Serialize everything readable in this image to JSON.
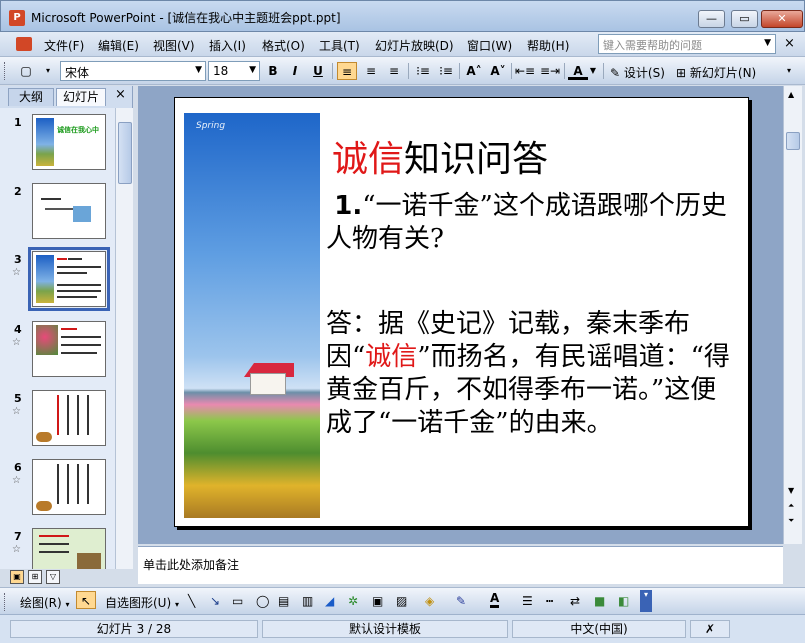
{
  "window": {
    "title": "Microsoft PowerPoint - [诚信在我心中主题班会ppt.ppt]",
    "app_icon": "P",
    "minimize": "—",
    "maximize": "▭",
    "close": "✕"
  },
  "menu": {
    "items": [
      "文件(F)",
      "编辑(E)",
      "视图(V)",
      "插入(I)",
      "格式(O)",
      "工具(T)",
      "幻灯片放映(D)",
      "窗口(W)",
      "帮助(H)"
    ],
    "help_placeholder": "键入需要帮助的问题",
    "close_glyph": "×"
  },
  "toolbar": {
    "font_name": "宋体",
    "font_size": "18",
    "bold": "B",
    "italic": "I",
    "underline": "U",
    "align_left": "≡",
    "align_center": "≡",
    "align_right": "≡",
    "numbering": "⁝≡",
    "bullets": "⁝≡",
    "grow_font": "A˄",
    "shrink_font": "A˅",
    "decrease_indent": "⇤≡",
    "increase_indent": "≡⇥",
    "font_color": "A",
    "design_label": "设计(S)",
    "new_slide_label": "新幻灯片(N)"
  },
  "left_pane": {
    "tab_outline": "大纲",
    "tab_slides": "幻灯片",
    "close_glyph": "×",
    "thumbnails": [
      {
        "num": "1",
        "title": "诚信在我心中"
      },
      {
        "num": "2"
      },
      {
        "num": "3",
        "selected": true
      },
      {
        "num": "4"
      },
      {
        "num": "5"
      },
      {
        "num": "6"
      },
      {
        "num": "7"
      }
    ]
  },
  "slide": {
    "photo_stamp": "Spring",
    "title_red": "诚信",
    "title_rest": "知识问答",
    "question_num": "1.",
    "question_text": "“一诺千金”这个成语跟哪个历史人物有关?",
    "answer_part1": "答：据《史记》记载，秦末季布因“",
    "answer_red": "诚信",
    "answer_part2": "”而扬名，有民谣唱道：“得黄金百斤，不如得季布一诺。”这便成了“一诺千金”的由来。"
  },
  "notes": {
    "placeholder": "单击此处添加备注"
  },
  "drawbar": {
    "draw_label": "绘图(R)",
    "autoshape_label": "自选图形(U)"
  },
  "status": {
    "slide_info": "幻灯片 3 / 28",
    "template": "默认设计模板",
    "language": "中文(中国)"
  }
}
